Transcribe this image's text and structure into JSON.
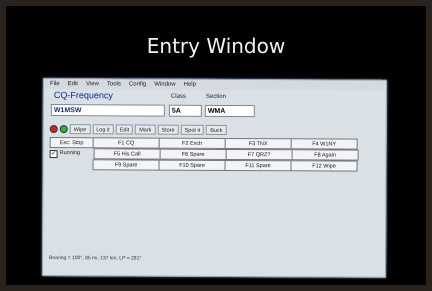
{
  "slide": {
    "title": "Entry Window"
  },
  "menu": [
    "File",
    "Edit",
    "View",
    "Tools",
    "Config",
    "Window",
    "Help"
  ],
  "entry": {
    "frequency_label": "CQ-Frequency",
    "class_label": "Class",
    "section_label": "Section",
    "callsign": "W1MSW",
    "class_value": "5A",
    "section_value": "WMA"
  },
  "toolbar": [
    "Wipe",
    "Log it",
    "Edit",
    "Mark",
    "Store",
    "Spot it",
    "Buck"
  ],
  "fkeys": {
    "esc": "Esc: Stop",
    "running": "Running",
    "row1": [
      "F1 CQ",
      "F2 Exch",
      "F3 TNX",
      "F4 W1NY"
    ],
    "row2": [
      "F5 His Call",
      "F6 Spare",
      "F7 QRZ?",
      "F8 Again"
    ],
    "row3": [
      "F9 Spare",
      "F10 Spare",
      "F11 Spare",
      "F12 Wipe"
    ]
  },
  "status": "Bearing = 100°, 85 mi, 137 km, LP = 281°",
  "colors": {
    "led_red": "#d42020",
    "led_green": "#2db82d"
  }
}
